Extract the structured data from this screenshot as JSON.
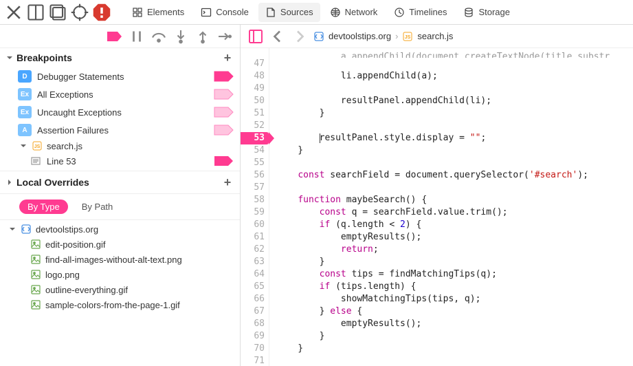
{
  "tabs": {
    "elements": "Elements",
    "console": "Console",
    "sources": "Sources",
    "network": "Network",
    "timelines": "Timelines",
    "storage": "Storage"
  },
  "breakpoints": {
    "title": "Breakpoints",
    "items": [
      {
        "badge": "D",
        "color": "#4aa6ff",
        "label": "Debugger Statements",
        "marker": "solid"
      },
      {
        "badge": "Ex",
        "color": "#7ec4ff",
        "label": "All Exceptions",
        "marker": "light"
      },
      {
        "badge": "Ex",
        "color": "#7ec4ff",
        "label": "Uncaught Exceptions",
        "marker": "light"
      },
      {
        "badge": "A",
        "color": "#7ec4ff",
        "label": "Assertion Failures",
        "marker": "light"
      }
    ],
    "file": "search.js",
    "line_label": "Line 53"
  },
  "overrides": {
    "title": "Local Overrides"
  },
  "filters": {
    "byType": "By Type",
    "byPath": "By Path"
  },
  "tree": {
    "root": "devtoolstips.org",
    "files": [
      "edit-position.gif",
      "find-all-images-without-alt-text.png",
      "logo.png",
      "outline-everything.gif",
      "sample-colors-from-the-page-1.gif"
    ]
  },
  "breadcrumb": {
    "domain": "devtoolstips.org",
    "file": "search.js"
  },
  "code": {
    "start": 47,
    "current": 53,
    "lines": [
      {
        "n": 47,
        "t": "",
        "html": ""
      },
      {
        "n": 48,
        "t": "            li.appendChild(a);",
        "html": "            li.appendChild(a);"
      },
      {
        "n": 49,
        "t": "",
        "html": ""
      },
      {
        "n": 50,
        "t": "            resultPanel.appendChild(li);",
        "html": "            resultPanel.appendChild(li);"
      },
      {
        "n": 51,
        "t": "        }",
        "html": "        }"
      },
      {
        "n": 52,
        "t": "",
        "html": ""
      },
      {
        "n": 53,
        "t": "        resultPanel.style.display = \"\";",
        "html": "        <span class='cursor'></span>resultPanel.style.display = <span class='str'>\"\"</span>;"
      },
      {
        "n": 54,
        "t": "    }",
        "html": "    }"
      },
      {
        "n": 55,
        "t": "",
        "html": ""
      },
      {
        "n": 56,
        "t": "    const searchField = document.querySelector('#search');",
        "html": "    <span class='kw'>const</span> searchField = document.querySelector(<span class='str'>'#search'</span>);"
      },
      {
        "n": 57,
        "t": "",
        "html": ""
      },
      {
        "n": 58,
        "t": "    function maybeSearch() {",
        "html": "    <span class='kw'>function</span> maybeSearch() {"
      },
      {
        "n": 59,
        "t": "        const q = searchField.value.trim();",
        "html": "        <span class='kw'>const</span> q = searchField.value.trim();"
      },
      {
        "n": 60,
        "t": "        if (q.length < 2) {",
        "html": "        <span class='kw'>if</span> (q.length &lt; <span class='num'>2</span>) {"
      },
      {
        "n": 61,
        "t": "            emptyResults();",
        "html": "            emptyResults();"
      },
      {
        "n": 62,
        "t": "            return;",
        "html": "            <span class='kw'>return</span>;"
      },
      {
        "n": 63,
        "t": "        }",
        "html": "        }"
      },
      {
        "n": 64,
        "t": "        const tips = findMatchingTips(q);",
        "html": "        <span class='kw'>const</span> tips = findMatchingTips(q);"
      },
      {
        "n": 65,
        "t": "        if (tips.length) {",
        "html": "        <span class='kw'>if</span> (tips.length) {"
      },
      {
        "n": 66,
        "t": "            showMatchingTips(tips, q);",
        "html": "            showMatchingTips(tips, q);"
      },
      {
        "n": 67,
        "t": "        } else {",
        "html": "        } <span class='kw'>else</span> {"
      },
      {
        "n": 68,
        "t": "            emptyResults();",
        "html": "            emptyResults();"
      },
      {
        "n": 69,
        "t": "        }",
        "html": "        }"
      },
      {
        "n": 70,
        "t": "    }",
        "html": "    }"
      },
      {
        "n": 71,
        "t": "",
        "html": ""
      }
    ]
  }
}
